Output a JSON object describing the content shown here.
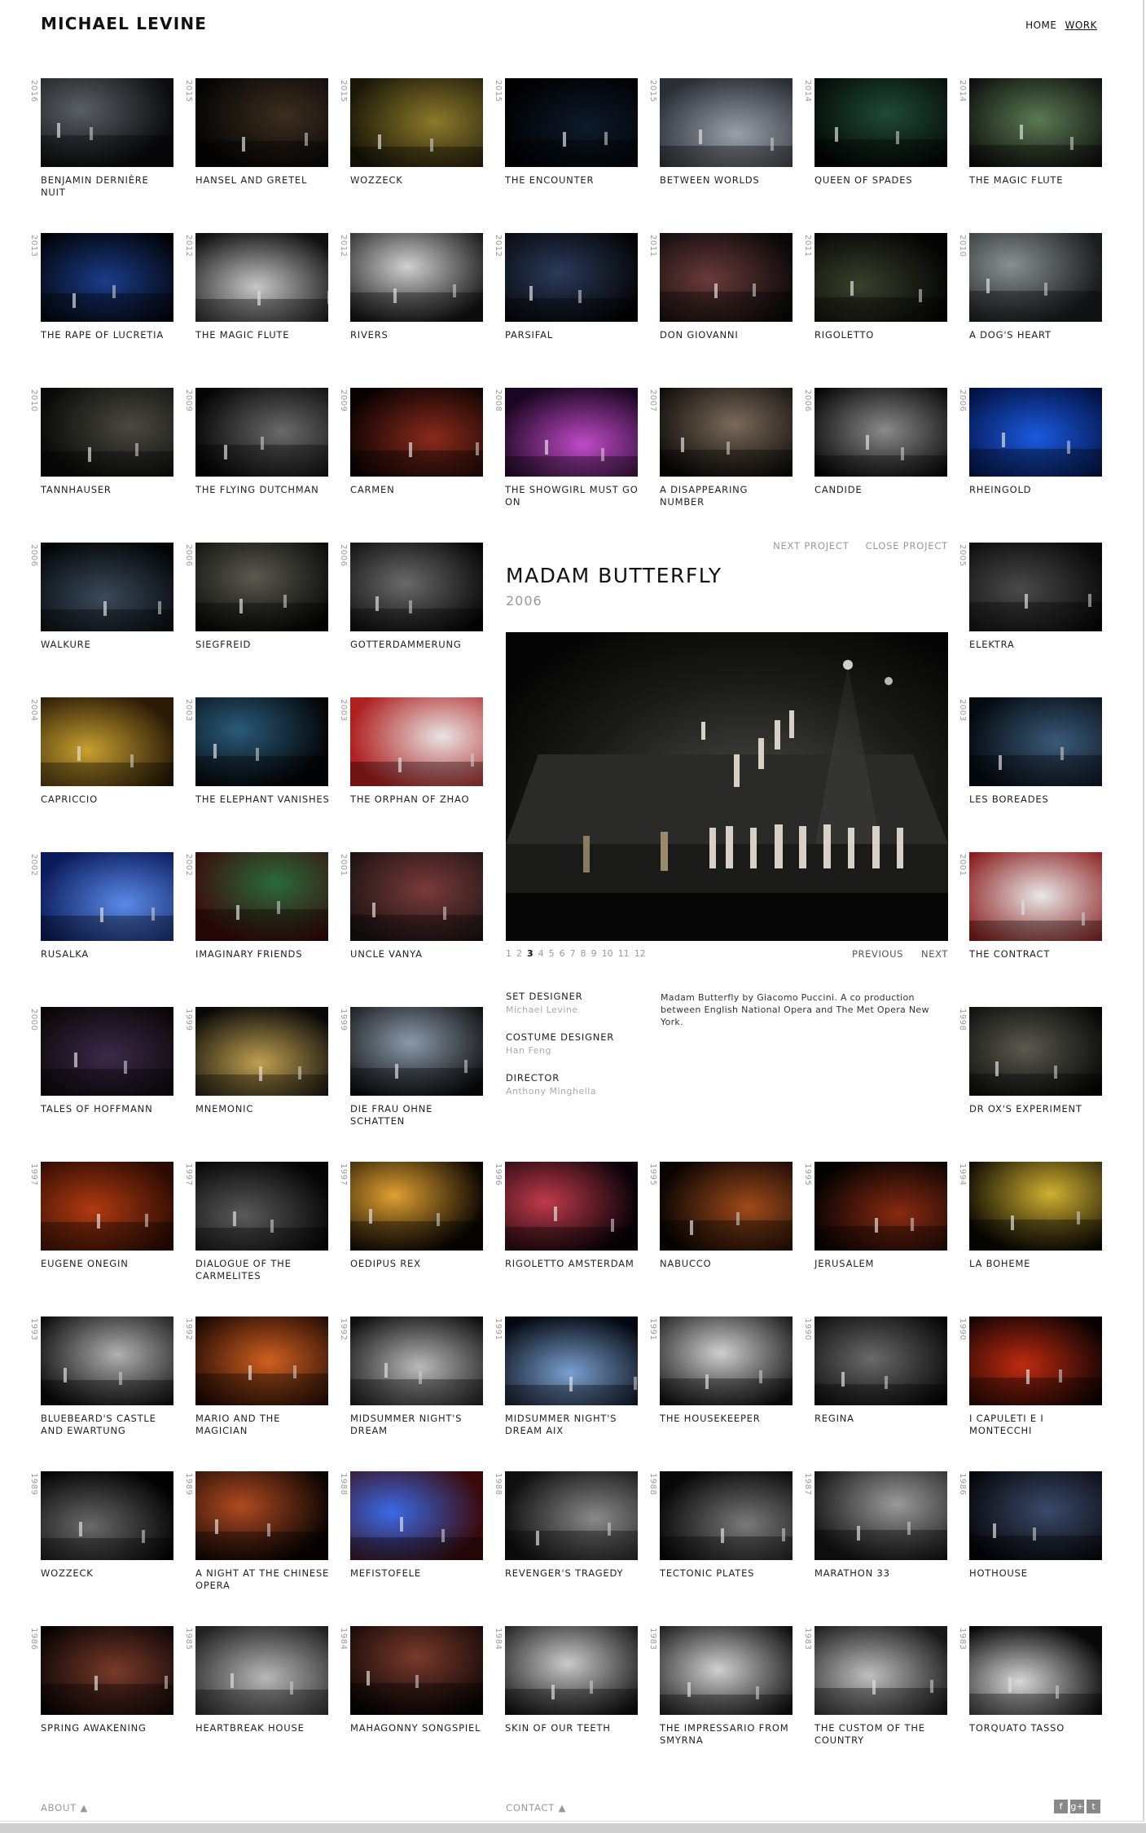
{
  "header": {
    "logo": "MICHAEL LEVINE",
    "nav": [
      {
        "label": "HOME"
      },
      {
        "label": "WORK"
      }
    ]
  },
  "works": [
    {
      "year": "2016",
      "title": "BENJAMIN DERNIÈRE NUIT",
      "c1": "#5a5f66",
      "c2": "#0c0c0e"
    },
    {
      "year": "2015",
      "title": "HANSEL AND GRETEL",
      "c1": "#3c2d1e",
      "c2": "#050505"
    },
    {
      "year": "2015",
      "title": "WOZZECK",
      "c1": "#8a7a2a",
      "c2": "#1a1608"
    },
    {
      "year": "2015",
      "title": "THE ENCOUNTER",
      "c1": "#0d1a2a",
      "c2": "#000000"
    },
    {
      "year": "2015",
      "title": "BETWEEN WORLDS",
      "c1": "#9aa0a8",
      "c2": "#2a2f36"
    },
    {
      "year": "2014",
      "title": "QUEEN OF SPADES",
      "c1": "#1f4a36",
      "c2": "#020404"
    },
    {
      "year": "2014",
      "title": "THE MAGIC FLUTE",
      "c1": "#5a7a52",
      "c2": "#0a0a0a"
    },
    {
      "year": "2013",
      "title": "THE RAPE OF LUCRETIA",
      "c1": "#1a3c8a",
      "c2": "#000000"
    },
    {
      "year": "2012",
      "title": "THE MAGIC FLUTE",
      "c1": "#c8c8c8",
      "c2": "#101010"
    },
    {
      "year": "2012",
      "title": "RIVERS",
      "c1": "#d0d0d0",
      "c2": "#121212"
    },
    {
      "year": "2012",
      "title": "PARSIFAL",
      "c1": "#2a3a5a",
      "c2": "#020202"
    },
    {
      "year": "2011",
      "title": "DON GIOVANNI",
      "c1": "#6a3a3a",
      "c2": "#0a0808"
    },
    {
      "year": "2011",
      "title": "RIGOLETTO",
      "c1": "#3a3f2a",
      "c2": "#050505"
    },
    {
      "year": "2010",
      "title": "A DOG'S HEART",
      "c1": "#8a9090",
      "c2": "#1a1d1f"
    },
    {
      "year": "2010",
      "title": "TANNHAUSER",
      "c1": "#4a4a40",
      "c2": "#0a0a0a"
    },
    {
      "year": "2009",
      "title": "THE FLYING DUTCHMAN",
      "c1": "#6a6a6a",
      "c2": "#050505"
    },
    {
      "year": "2009",
      "title": "CARMEN",
      "c1": "#8a2a1a",
      "c2": "#0a0202"
    },
    {
      "year": "2008",
      "title": "THE SHOWGIRL MUST GO ON",
      "c1": "#c04ac8",
      "c2": "#1a0620"
    },
    {
      "year": "2007",
      "title": "A DISAPPEARING NUMBER",
      "c1": "#7a6a5a",
      "c2": "#0a0806"
    },
    {
      "year": "2006",
      "title": "CANDIDE",
      "c1": "#8a8a8a",
      "c2": "#000000"
    },
    {
      "year": "2006",
      "title": "RHEINGOLD",
      "c1": "#1a5ae0",
      "c2": "#021040"
    },
    {
      "year": "2006",
      "title": "WALKURE",
      "c1": "#3a4a5a",
      "c2": "#030608"
    },
    {
      "year": "2006",
      "title": "SIEGFREID",
      "c1": "#5a5a50",
      "c2": "#060606"
    },
    {
      "year": "2006",
      "title": "GOTTERDAMMERUNG",
      "c1": "#6a6a6a",
      "c2": "#050505"
    },
    {
      "year": "2005",
      "title": "ELEKTRA",
      "c1": "#4a4a4a",
      "c2": "#080808"
    },
    {
      "year": "2004",
      "title": "CAPRICCIO",
      "c1": "#c8a030",
      "c2": "#2a1a06"
    },
    {
      "year": "2003",
      "title": "THE ELEPHANT VANISHES",
      "c1": "#2a5a7a",
      "c2": "#040608"
    },
    {
      "year": "2003",
      "title": "THE ORPHAN OF ZHAO",
      "c1": "#e8e4e4",
      "c2": "#b02020"
    },
    {
      "year": "2003",
      "title": "LES BOREADES",
      "c1": "#3a5a7a",
      "c2": "#050a10"
    },
    {
      "year": "2002",
      "title": "RUSALKA",
      "c1": "#5a8ae8",
      "c2": "#0a1a5a"
    },
    {
      "year": "2002",
      "title": "IMAGINARY FRIENDS",
      "c1": "#2a6a3a",
      "c2": "#3a0a0a"
    },
    {
      "year": "2001",
      "title": "UNCLE VANYA",
      "c1": "#7a3a3a",
      "c2": "#1a1212"
    },
    {
      "year": "2001",
      "title": "THE CONTRACT",
      "c1": "#e8e8e8",
      "c2": "#8a1a1a"
    },
    {
      "year": "2000",
      "title": "TALES OF HOFFMANN",
      "c1": "#3a2a4a",
      "c2": "#0a0505"
    },
    {
      "year": "1999",
      "title": "MNEMONIC",
      "c1": "#c0a050",
      "c2": "#080808"
    },
    {
      "year": "1999",
      "title": "DIE FRAU OHNE SCHATTEN",
      "c1": "#8a9aaa",
      "c2": "#0a0a0a"
    },
    {
      "year": "1998",
      "title": "DR OX'S EXPERIMENT",
      "c1": "#5a5a50",
      "c2": "#050505"
    },
    {
      "year": "1997",
      "title": "EUGENE ONEGIN",
      "c1": "#b03a10",
      "c2": "#2a0a02"
    },
    {
      "year": "1997",
      "title": "DIALOGUE OF THE CARMELITES",
      "c1": "#5a5a5a",
      "c2": "#050505"
    },
    {
      "year": "1997",
      "title": "OEDIPUS REX",
      "c1": "#e0a030",
      "c2": "#0a0502"
    },
    {
      "year": "1996",
      "title": "RIGOLETTO AMSTERDAM",
      "c1": "#c03a4a",
      "c2": "#0a0208"
    },
    {
      "year": "1995",
      "title": "NABUCCO",
      "c1": "#a04a1a",
      "c2": "#0a0402"
    },
    {
      "year": "1995",
      "title": "JERUSALEM",
      "c1": "#8a2a10",
      "c2": "#050202"
    },
    {
      "year": "1994",
      "title": "LA BOHEME",
      "c1": "#d0b030",
      "c2": "#0a0802"
    },
    {
      "year": "1993",
      "title": "BLUEBEARD'S CASTLE AND EWARTUNG",
      "c1": "#b0b0b0",
      "c2": "#0a0a0a"
    },
    {
      "year": "1992",
      "title": "MARIO AND THE MAGICIAN",
      "c1": "#d06020",
      "c2": "#1a0602"
    },
    {
      "year": "1992",
      "title": "MIDSUMMER NIGHT'S DREAM",
      "c1": "#bababa",
      "c2": "#101010"
    },
    {
      "year": "1991",
      "title": "MIDSUMMER NIGHT'S DREAM AIX",
      "c1": "#7aa0d0",
      "c2": "#040810"
    },
    {
      "year": "1991",
      "title": "THE HOUSEKEEPER",
      "c1": "#cfcfcf",
      "c2": "#101010"
    },
    {
      "year": "1990",
      "title": "REGINA",
      "c1": "#6a6a6a",
      "c2": "#050505"
    },
    {
      "year": "1990",
      "title": "I CAPULETI E I MONTECCHI",
      "c1": "#c02a10",
      "c2": "#0a0202"
    },
    {
      "year": "1989",
      "title": "WOZZECK",
      "c1": "#6a6a6a",
      "c2": "#020202"
    },
    {
      "year": "1989",
      "title": "A NIGHT AT THE CHINESE OPERA",
      "c1": "#b04a20",
      "c2": "#0a0402"
    },
    {
      "year": "1988",
      "title": "MEFISTOFELE",
      "c1": "#3a6ae8",
      "c2": "#3a0a0a"
    },
    {
      "year": "1988",
      "title": "REVENGER'S TRAGEDY",
      "c1": "#8a8a8a",
      "c2": "#101010"
    },
    {
      "year": "1988",
      "title": "TECTONIC PLATES",
      "c1": "#7a7a7a",
      "c2": "#080808"
    },
    {
      "year": "1987",
      "title": "MARATHON 33",
      "c1": "#9a9a9a",
      "c2": "#151515"
    },
    {
      "year": "1986",
      "title": "HOTHOUSE",
      "c1": "#3a4a6a",
      "c2": "#050508"
    },
    {
      "year": "1986",
      "title": "SPRING AWAKENING",
      "c1": "#7a3a2a",
      "c2": "#050202"
    },
    {
      "year": "1985",
      "title": "HEARTBREAK HOUSE",
      "c1": "#b8b8b8",
      "c2": "#222222"
    },
    {
      "year": "1984",
      "title": "MAHAGONNY SONGSPIEL",
      "c1": "#7a3a2a",
      "c2": "#0a0404"
    },
    {
      "year": "1984",
      "title": "SKIN OF OUR TEETH",
      "c1": "#cacaca",
      "c2": "#101010"
    },
    {
      "year": "1983",
      "title": "THE IMPRESSARIO FROM SMYRNA",
      "c1": "#d0d0d0",
      "c2": "#101010"
    },
    {
      "year": "1983",
      "title": "THE CUSTOM OF THE COUNTRY",
      "c1": "#c0c0c0",
      "c2": "#181818"
    },
    {
      "year": "1983",
      "title": "TORQUATO TASSO",
      "c1": "#d8d8d8",
      "c2": "#080808"
    }
  ],
  "detail": {
    "next_label": "NEXT PROJECT",
    "close_label": "CLOSE PROJECT",
    "title": "MADAM BUTTERFLY",
    "year": "2006",
    "pages": [
      "1",
      "2",
      "3",
      "4",
      "5",
      "6",
      "7",
      "8",
      "9",
      "10",
      "11",
      "12"
    ],
    "current_page": 3,
    "previous_label": "PREVIOUS",
    "next_label2": "NEXT",
    "credits": [
      {
        "role": "SET DESIGNER",
        "name": "Michael Levine"
      },
      {
        "role": "COSTUME DESIGNER",
        "name": "Han Feng"
      },
      {
        "role": "DIRECTOR",
        "name": "Anthony Minghella"
      }
    ],
    "description": "Madam Butterfly by Giacomo Puccini.  A co production between English National Opera and The Met Opera New York."
  },
  "footer": {
    "about": "ABOUT",
    "contact": "CONTACT",
    "social": [
      "f",
      "g+",
      "t"
    ]
  }
}
